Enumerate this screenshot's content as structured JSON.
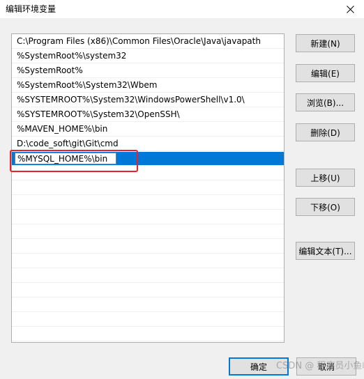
{
  "window": {
    "title": "编辑环境变量",
    "close_icon": "close-icon"
  },
  "path_list": {
    "items": [
      "C:\\Program Files (x86)\\Common Files\\Oracle\\Java\\javapath",
      "%SystemRoot%\\system32",
      "%SystemRoot%",
      "%SystemRoot%\\System32\\Wbem",
      "%SYSTEMROOT%\\System32\\WindowsPowerShell\\v1.0\\",
      "%SYSTEMROOT%\\System32\\OpenSSH\\",
      "%MAVEN_HOME%\\bin",
      "D:\\code_soft\\git\\Git\\cmd"
    ],
    "editing_value": "%MYSQL_HOME%\\bin",
    "selected_color": "#0078d7",
    "highlight_color": "#e8222a"
  },
  "buttons": {
    "new": "新建(N)",
    "edit": "编辑(E)",
    "browse": "浏览(B)...",
    "delete": "删除(D)",
    "move_up": "上移(U)",
    "move_down": "下移(O)",
    "edit_text": "编辑文本(T)...",
    "ok": "确定",
    "cancel": "取消"
  },
  "watermark": "CSDN @ 程序员小鱼峰"
}
